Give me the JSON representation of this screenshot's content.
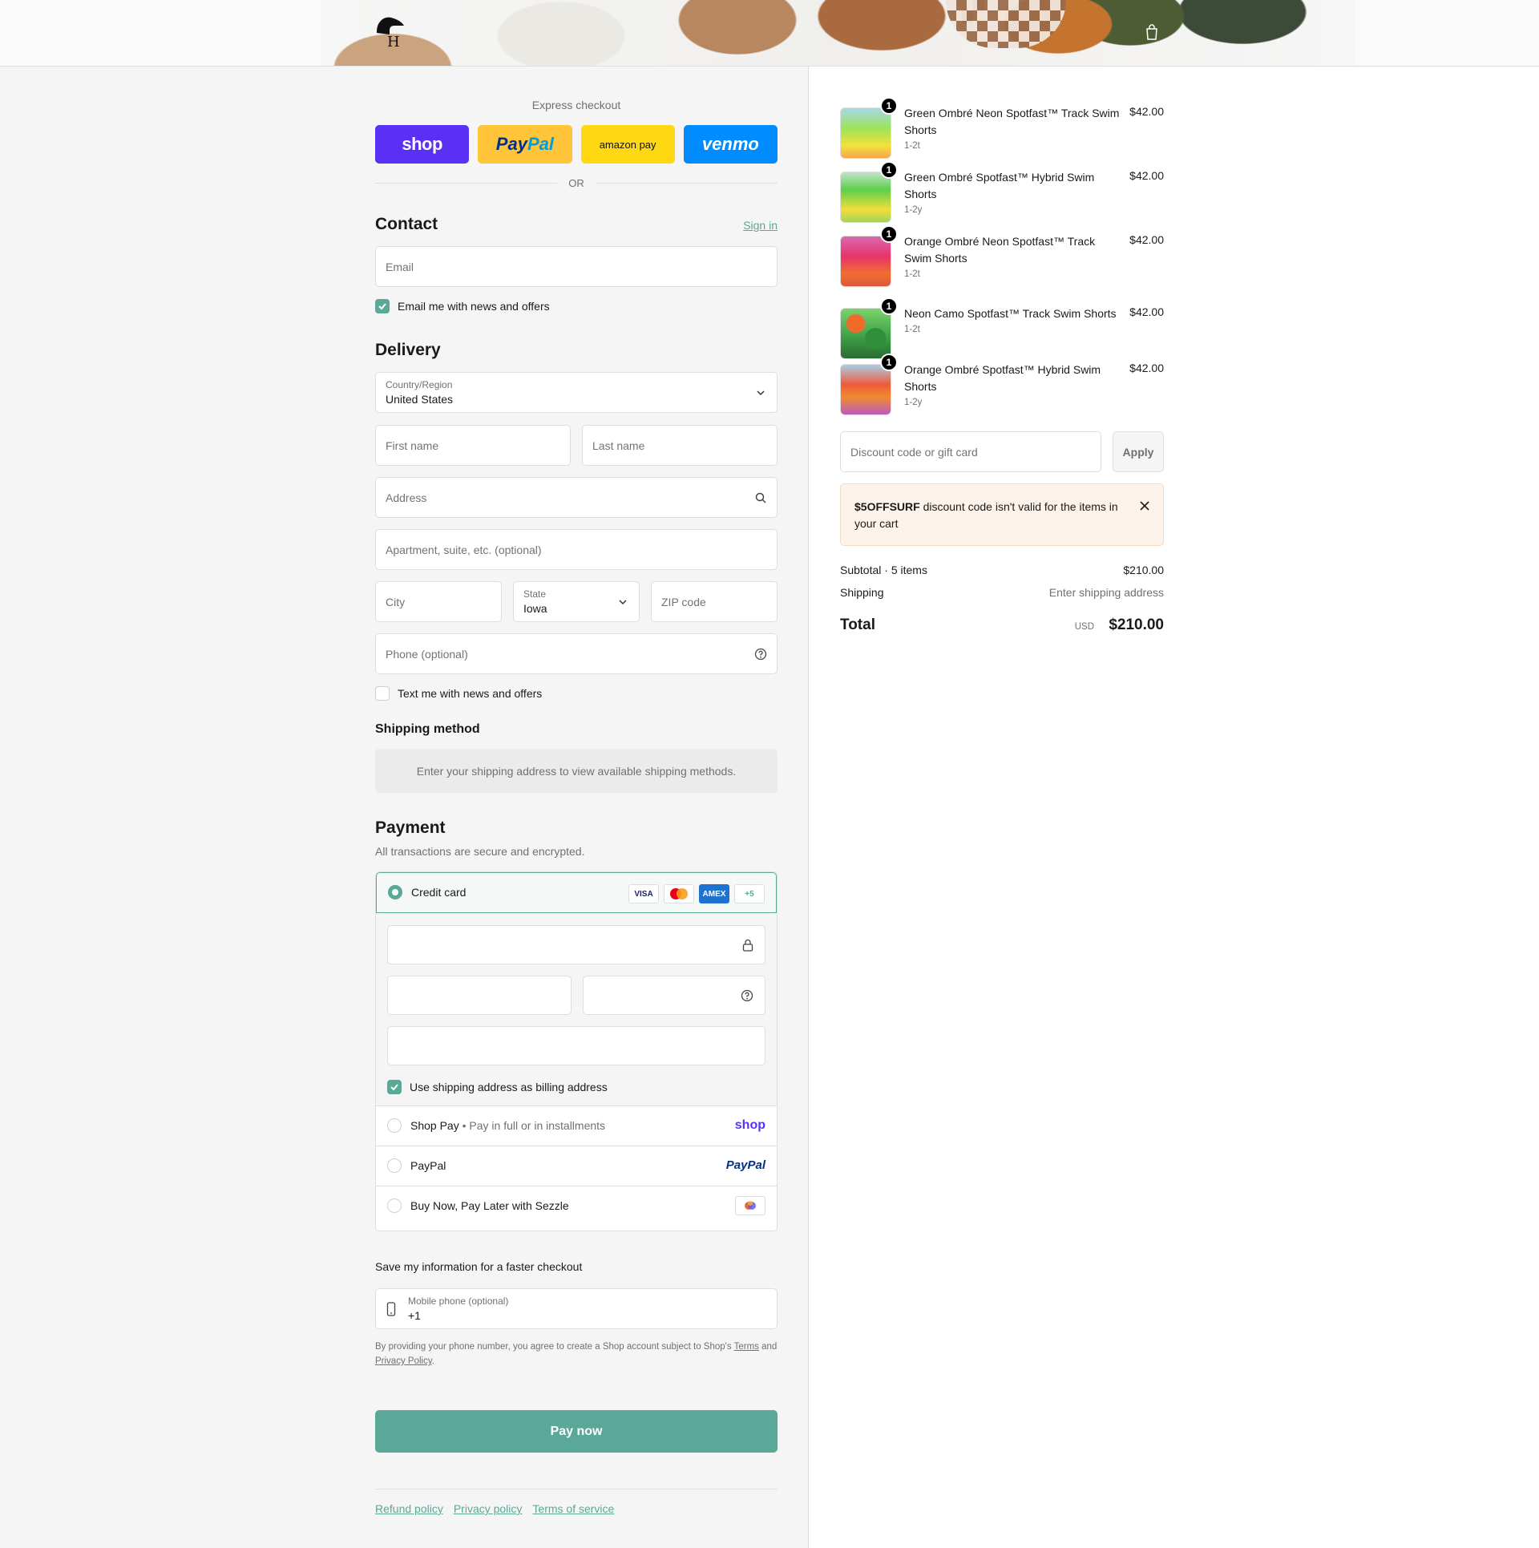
{
  "express": {
    "title": "Express checkout",
    "shop_label": "shop",
    "paypal_label_1": "Pay",
    "paypal_label_2": "Pal",
    "amazon_label": "amazon pay",
    "venmo_label": "venmo",
    "or_label": "OR"
  },
  "contact": {
    "heading": "Contact",
    "sign_in": "Sign in",
    "email_placeholder": "Email",
    "newsletter_label": "Email me with news and offers",
    "newsletter_checked": true
  },
  "delivery": {
    "heading": "Delivery",
    "country_label": "Country/Region",
    "country_value": "United States",
    "first_name_placeholder": "First name",
    "last_name_placeholder": "Last name",
    "address_placeholder": "Address",
    "apartment_placeholder": "Apartment, suite, etc. (optional)",
    "city_placeholder": "City",
    "state_label": "State",
    "state_value": "Iowa",
    "zip_placeholder": "ZIP code",
    "phone_placeholder": "Phone (optional)",
    "sms_label": "Text me with news and offers",
    "sms_checked": false
  },
  "shipping": {
    "heading": "Shipping method",
    "message": "Enter your shipping address to view available shipping methods."
  },
  "payment": {
    "heading": "Payment",
    "subtitle": "All transactions are secure and encrypted.",
    "credit_card_label": "Credit card",
    "card_badges": [
      "VISA",
      "MC",
      "AMEX",
      "+5"
    ],
    "billing_same_label": "Use shipping address as billing address",
    "billing_same_checked": true,
    "shop_pay_label": "Shop Pay",
    "shop_pay_sub": "Pay in full or in installments",
    "shop_pay_logo": "shop",
    "paypal_label": "PayPal",
    "paypal_logo": "PayPal",
    "sezzle_label": "Buy Now, Pay Later with Sezzle"
  },
  "save_info": {
    "heading": "Save my information for a faster checkout",
    "mobile_label": "Mobile phone (optional)",
    "mobile_value": "+1",
    "legal_1": "By providing your phone number, you agree to create a Shop account subject to Shop's",
    "legal_terms": "Terms",
    "legal_and": "and",
    "legal_privacy": "Privacy Policy",
    "legal_end": "."
  },
  "pay_now": "Pay now",
  "footer_links": [
    "Refund policy",
    "Privacy policy",
    "Terms of service"
  ],
  "cart": {
    "items": [
      {
        "name": "Green Ombré Neon Spotfast™ Track Swim Shorts",
        "variant": "1-2t",
        "price": "$42.00",
        "qty": "1"
      },
      {
        "name": "Green Ombré Spotfast™ Hybrid Swim Shorts",
        "variant": "1-2y",
        "price": "$42.00",
        "qty": "1"
      },
      {
        "name": "Orange Ombré Neon Spotfast™ Track Swim Shorts",
        "variant": "1-2t",
        "price": "$42.00",
        "qty": "1"
      },
      {
        "name": "Neon Camo Spotfast™ Track Swim Shorts",
        "variant": "1-2t",
        "price": "$42.00",
        "qty": "1"
      },
      {
        "name": "Orange Ombré Spotfast™ Hybrid Swim Shorts",
        "variant": "1-2y",
        "price": "$42.00",
        "qty": "1"
      }
    ],
    "discount_placeholder": "Discount code or gift card",
    "apply_label": "Apply",
    "notice_code": "$5OFFSURF",
    "notice_text": " discount code isn't valid for the items in your cart",
    "subtotal_label": "Subtotal · 5 items",
    "subtotal_value": "$210.00",
    "shipping_label": "Shipping",
    "shipping_value": "Enter shipping address",
    "total_label": "Total",
    "total_currency": "USD",
    "total_value": "$210.00"
  },
  "colors": {
    "accent": "#5aa897",
    "shop_purple": "#5a31f4",
    "paypal_yellow": "#ffc439",
    "amazon_yellow": "#ffd814",
    "venmo_blue": "#008cff",
    "notice_bg": "#fdf3ea"
  }
}
